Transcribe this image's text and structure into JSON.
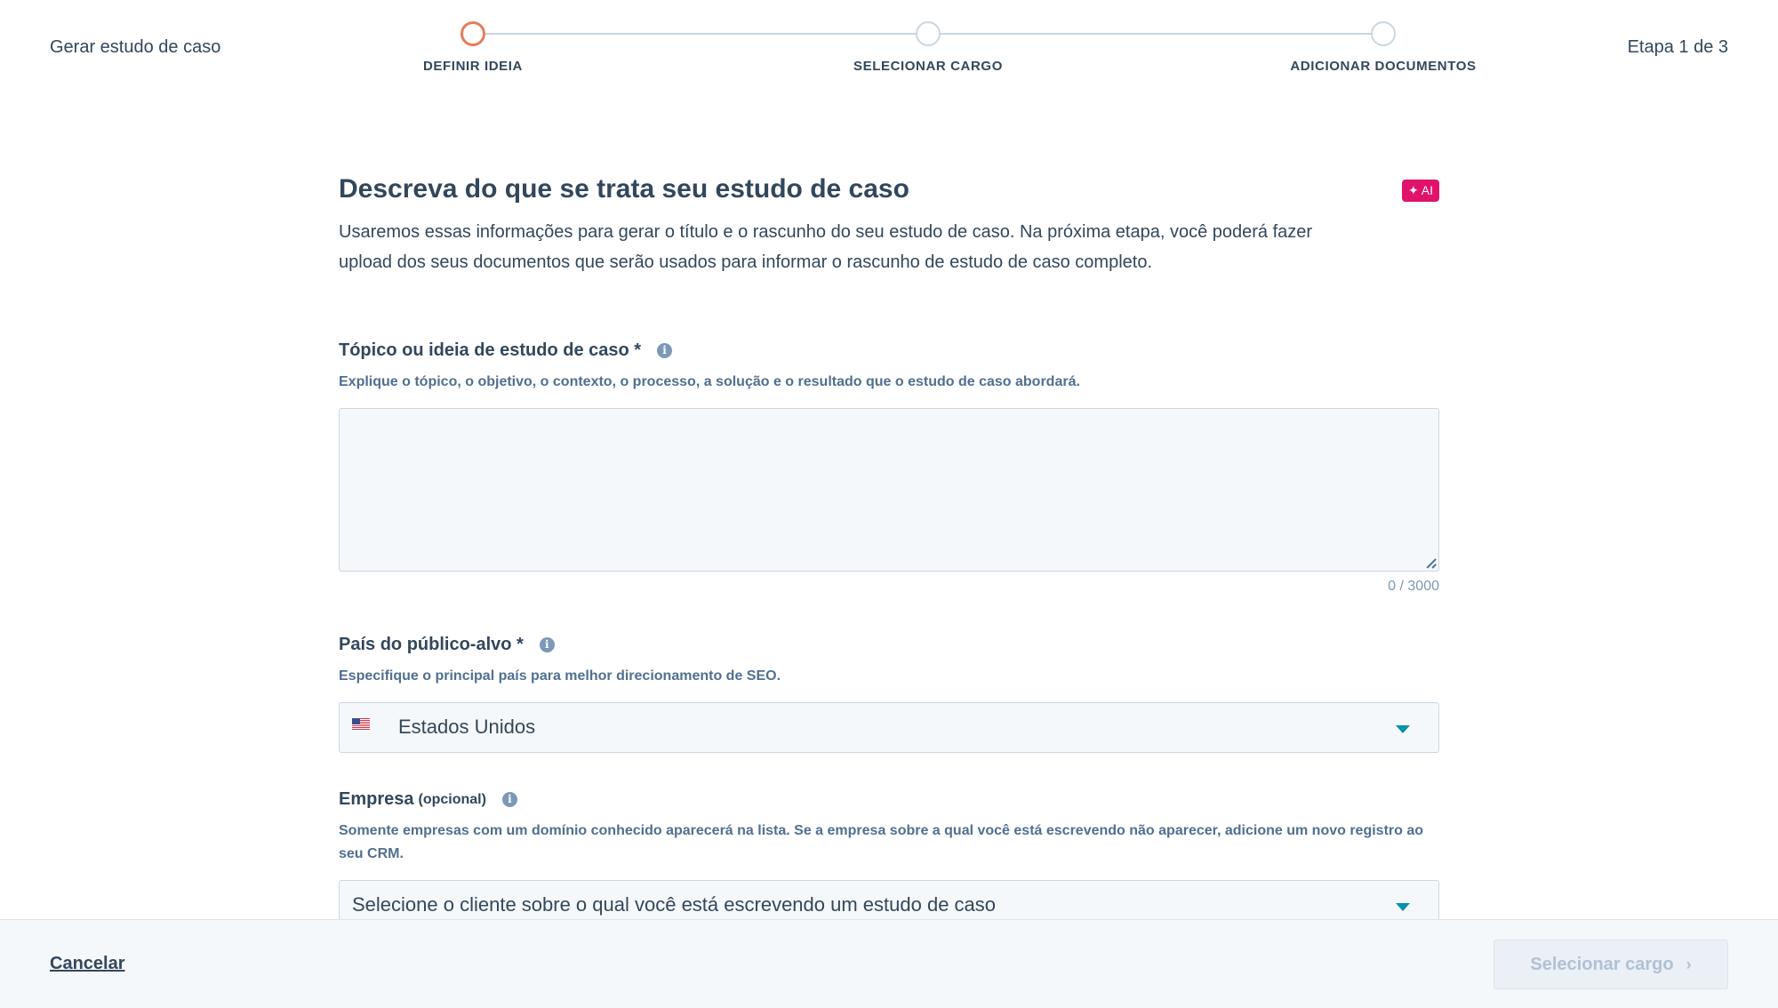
{
  "header": {
    "flow_title": "Gerar estudo de caso",
    "step_counter": "Etapa 1 de 3",
    "steps": [
      {
        "label": "DEFINIR IDEIA",
        "active": true
      },
      {
        "label": "SELECIONAR CARGO",
        "active": false
      },
      {
        "label": "ADICIONAR DOCUMENTOS",
        "active": false
      }
    ]
  },
  "main": {
    "title": "Descreva do que se trata seu estudo de caso",
    "ai_badge": "AI",
    "intro": "Usaremos essas informações para gerar o título e o rascunho do seu estudo de caso. Na próxima etapa, você poderá fazer upload dos seus documentos que serão usados para informar o rascunho de estudo de caso completo.",
    "topic": {
      "label": "Tópico ou ideia de estudo de caso *",
      "help": "Explique o tópico, o objetivo, o contexto, o processo, a solução e o resultado que o estudo de caso abordará.",
      "value": "",
      "char_count": "0 / 3000"
    },
    "country": {
      "label": "País do público-alvo *",
      "help": "Especifique o principal país para melhor direcionamento de SEO.",
      "selected": "Estados Unidos",
      "flag_icon": "us-flag-icon"
    },
    "company": {
      "label": "Empresa",
      "optional": "(opcional)",
      "help": "Somente empresas com um domínio conhecido aparecerá na lista. Se a empresa sobre a qual você está escrevendo não aparecer, adicione um novo registro ao seu CRM.",
      "placeholder": "Selecione o cliente sobre o qual você está escrevendo um estudo de caso"
    }
  },
  "footer": {
    "cancel_label": "Cancelar",
    "next_label": "Selecionar cargo"
  },
  "colors": {
    "accent": "#0091ae",
    "active_step": "#ea7b5c",
    "ai_badge": "#e1126b",
    "text": "#33475b"
  }
}
